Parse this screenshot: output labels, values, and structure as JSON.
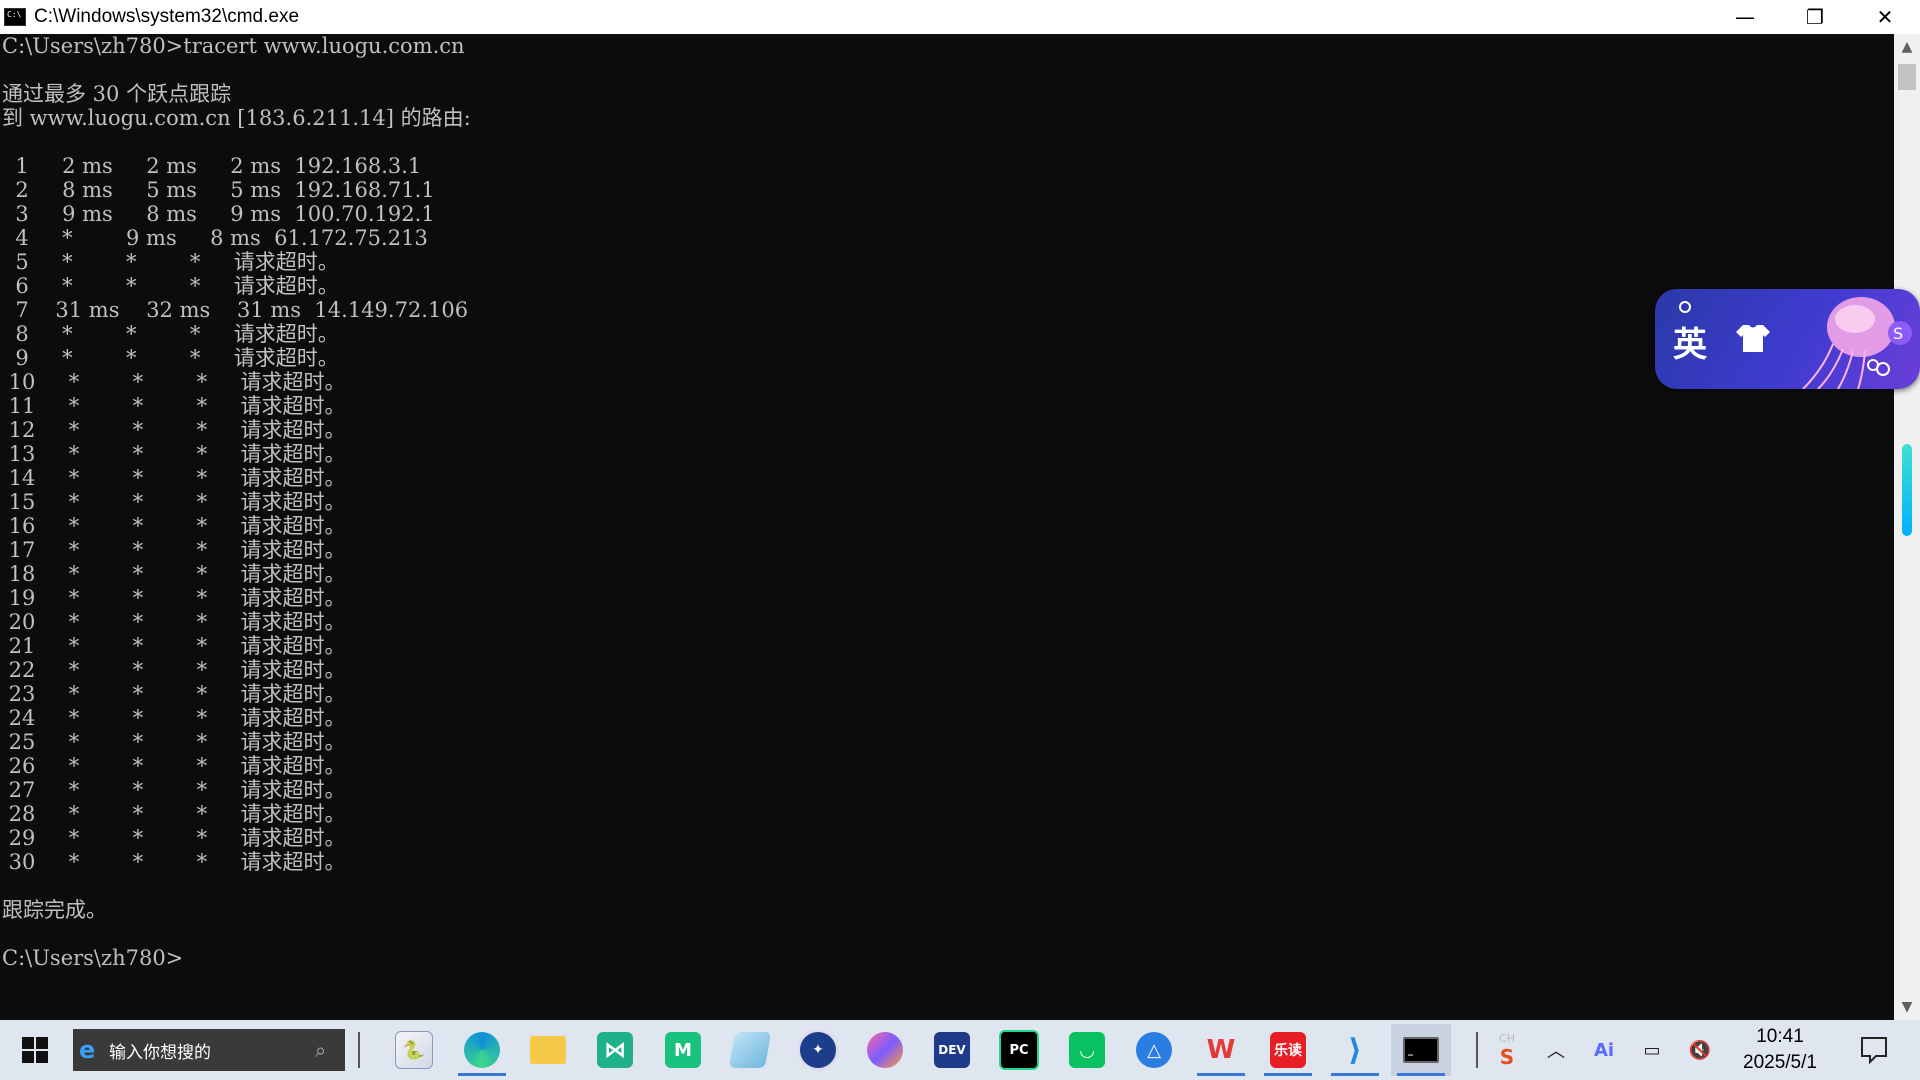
{
  "window": {
    "title": "C:\\Windows\\system32\\cmd.exe",
    "minimize": "—",
    "restore": "❐",
    "close": "✕"
  },
  "console": {
    "lines": [
      "C:\\Users\\zh780>tracert www.luogu.com.cn",
      "",
      "通过最多 30 个跃点跟踪",
      "到 www.luogu.com.cn [183.6.211.14] 的路由:",
      "",
      "  1     2 ms     2 ms     2 ms  192.168.3.1",
      "  2     8 ms     5 ms     5 ms  192.168.71.1",
      "  3     9 ms     8 ms     9 ms  100.70.192.1",
      "  4     *        9 ms     8 ms  61.172.75.213",
      "  5     *        *        *     请求超时。",
      "  6     *        *        *     请求超时。",
      "  7    31 ms    32 ms    31 ms  14.149.72.106",
      "  8     *        *        *     请求超时。",
      "  9     *        *        *     请求超时。",
      " 10     *        *        *     请求超时。",
      " 11     *        *        *     请求超时。",
      " 12     *        *        *     请求超时。",
      " 13     *        *        *     请求超时。",
      " 14     *        *        *     请求超时。",
      " 15     *        *        *     请求超时。",
      " 16     *        *        *     请求超时。",
      " 17     *        *        *     请求超时。",
      " 18     *        *        *     请求超时。",
      " 19     *        *        *     请求超时。",
      " 20     *        *        *     请求超时。",
      " 21     *        *        *     请求超时。",
      " 22     *        *        *     请求超时。",
      " 23     *        *        *     请求超时。",
      " 24     *        *        *     请求超时。",
      " 25     *        *        *     请求超时。",
      " 26     *        *        *     请求超时。",
      " 27     *        *        *     请求超时。",
      " 28     *        *        *     请求超时。",
      " 29     *        *        *     请求超时。",
      " 30     *        *        *     请求超时。",
      "",
      "跟踪完成。",
      "",
      "C:\\Users\\zh780>"
    ]
  },
  "ime_widget": {
    "char": "英"
  },
  "taskbar": {
    "search_placeholder": "输入你想搜的",
    "apps": [
      {
        "name": "python-idle",
        "label": ""
      },
      {
        "name": "edge",
        "label": ""
      },
      {
        "name": "file-explorer",
        "label": ""
      },
      {
        "name": "xmind",
        "label": ""
      },
      {
        "name": "xmind-green",
        "label": ""
      },
      {
        "name": "notepad",
        "label": ""
      },
      {
        "name": "steering-app",
        "label": ""
      },
      {
        "name": "drop-app",
        "label": ""
      },
      {
        "name": "dev-cpp",
        "label": "DEV"
      },
      {
        "name": "pycharm",
        "label": "PC"
      },
      {
        "name": "green-bag-app",
        "label": ""
      },
      {
        "name": "triangle-app",
        "label": ""
      },
      {
        "name": "wps",
        "label": ""
      },
      {
        "name": "ledu",
        "label": "乐读"
      },
      {
        "name": "vscode",
        "label": ""
      },
      {
        "name": "cmd",
        "label": ""
      }
    ],
    "tray": {
      "ime_label": "CH",
      "clock_time": "10:41",
      "clock_date": "2025/5/1"
    }
  }
}
